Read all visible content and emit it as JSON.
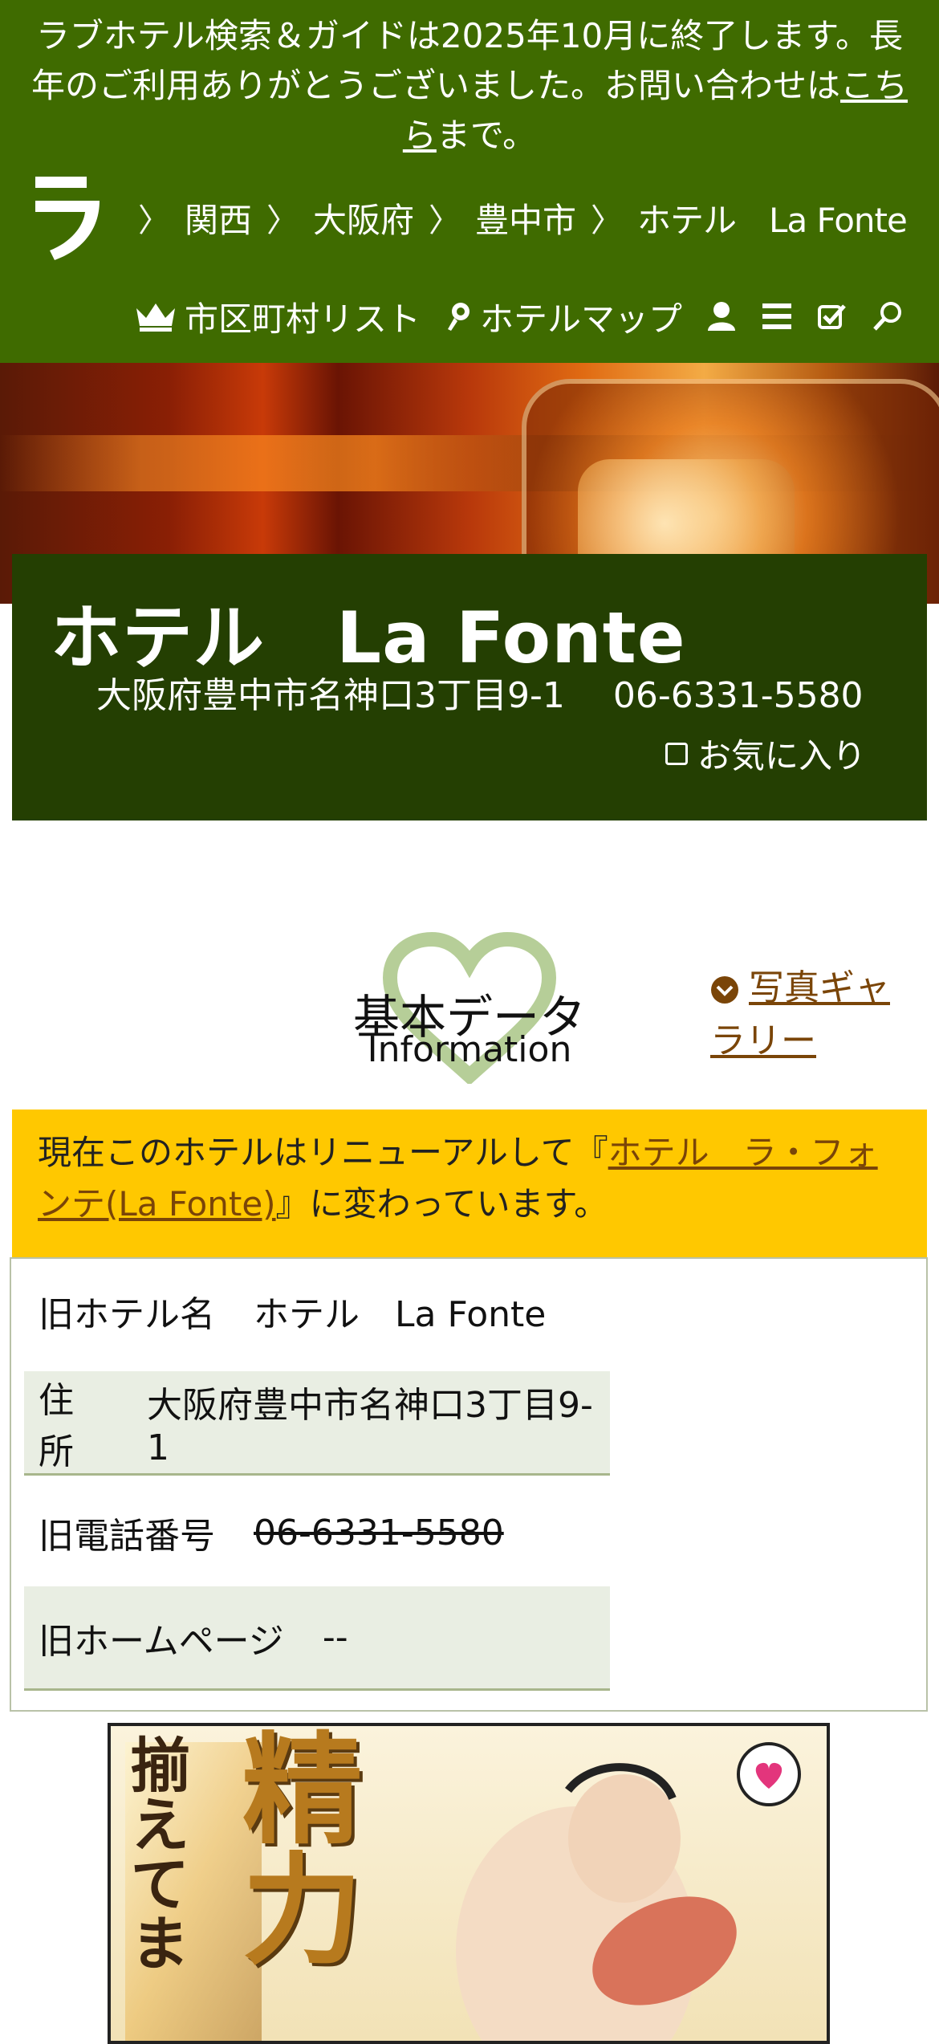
{
  "notice": {
    "text_before": "ラブホテル検索＆ガイドは2025年10月に終了します。長年のご利用ありがとうございました。お問い合わせは",
    "link": "こちら",
    "text_after": "まで。"
  },
  "logo": {
    "glyph": "ラ"
  },
  "breadcrumb": {
    "separator": "〉",
    "items": [
      "関西",
      "大阪府",
      "豊中市",
      "ホテル　La Fonte"
    ]
  },
  "toolbar": {
    "city_list": "市区町村リスト",
    "hotel_map": "ホテルマップ",
    "icons": [
      "crown-icon",
      "pin-icon",
      "user-icon",
      "menu-icon",
      "checklist-icon",
      "search-icon"
    ]
  },
  "hotel": {
    "name": "ホテル　La Fonte",
    "address": "大阪府豊中市名神口3丁目9-1",
    "phone": "06-6331-5580",
    "favorite_label": "お気に入り"
  },
  "section": {
    "title": "基本データ",
    "subtitle": "Information",
    "gallery_link": "写真ギャラリー"
  },
  "renewal": {
    "text_before": "現在このホテルはリニューアルして『",
    "link": "ホテル　ラ・フォンテ(La Fonte)",
    "text_after": "』に変わっています。"
  },
  "info_rows": [
    {
      "label": "旧ホテル名",
      "value": "ホテル　La Fonte"
    },
    {
      "label": "住所",
      "value": "大阪府豊中市名神口3丁目9-1"
    },
    {
      "label": "旧電話番号",
      "value": "06-6331-5580"
    },
    {
      "label": "旧ホームページ",
      "value": "--"
    }
  ],
  "banner": {
    "big_text": "精力",
    "side_text": "揃えてま"
  },
  "colors": {
    "header_green": "#3f6b00",
    "title_green": "#243f02",
    "notice_yellow": "#ffc800",
    "link_brown": "#7a4508",
    "row_alt": "#e9eee3"
  }
}
